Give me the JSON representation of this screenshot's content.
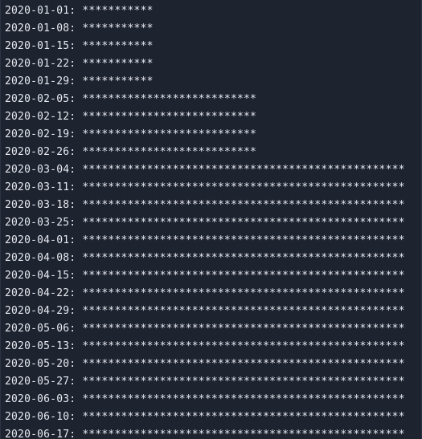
{
  "terminal": {
    "lines": [
      {
        "date": "2020-01-01:",
        "stars": "***********"
      },
      {
        "date": "2020-01-08:",
        "stars": "***********"
      },
      {
        "date": "2020-01-15:",
        "stars": "***********"
      },
      {
        "date": "2020-01-22:",
        "stars": "***********"
      },
      {
        "date": "2020-01-29:",
        "stars": "***********"
      },
      {
        "date": "2020-02-05:",
        "stars": "***************************"
      },
      {
        "date": "2020-02-12:",
        "stars": "***************************"
      },
      {
        "date": "2020-02-19:",
        "stars": "***************************"
      },
      {
        "date": "2020-02-26:",
        "stars": "***************************"
      },
      {
        "date": "2020-03-04:",
        "stars": "**************************************************"
      },
      {
        "date": "2020-03-11:",
        "stars": "**************************************************"
      },
      {
        "date": "2020-03-18:",
        "stars": "**************************************************"
      },
      {
        "date": "2020-03-25:",
        "stars": "**************************************************"
      },
      {
        "date": "2020-04-01:",
        "stars": "**************************************************"
      },
      {
        "date": "2020-04-08:",
        "stars": "**************************************************"
      },
      {
        "date": "2020-04-15:",
        "stars": "**************************************************"
      },
      {
        "date": "2020-04-22:",
        "stars": "**************************************************"
      },
      {
        "date": "2020-04-29:",
        "stars": "**************************************************"
      },
      {
        "date": "2020-05-06:",
        "stars": "**************************************************"
      },
      {
        "date": "2020-05-13:",
        "stars": "**************************************************"
      },
      {
        "date": "2020-05-20:",
        "stars": "**************************************************"
      },
      {
        "date": "2020-05-27:",
        "stars": "**************************************************"
      },
      {
        "date": "2020-06-03:",
        "stars": "**************************************************"
      },
      {
        "date": "2020-06-10:",
        "stars": "**************************************************"
      },
      {
        "date": "2020-06-17:",
        "stars": "**************************************************"
      }
    ]
  }
}
